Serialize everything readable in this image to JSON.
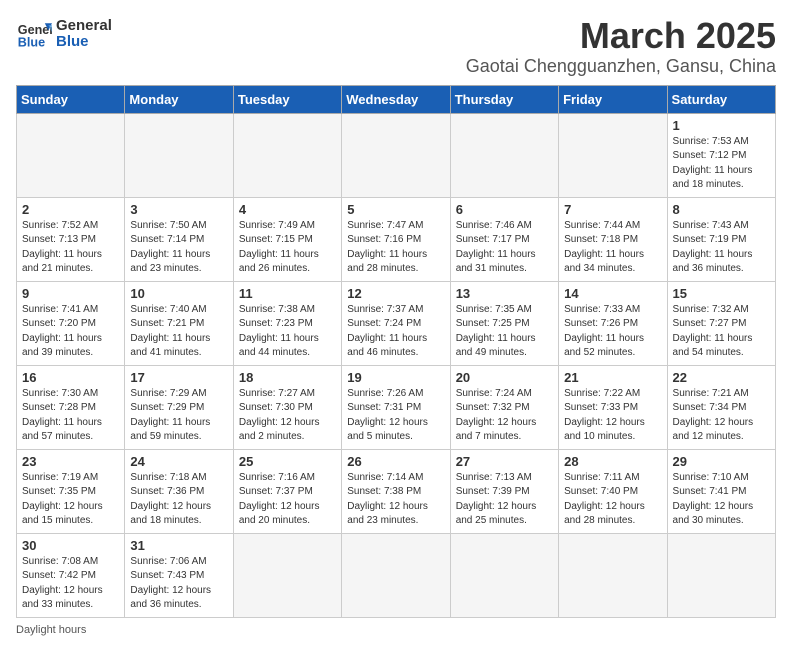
{
  "header": {
    "logo_text_general": "General",
    "logo_text_blue": "Blue",
    "month_title": "March 2025",
    "location": "Gaotai Chengguanzhen, Gansu, China"
  },
  "days_of_week": [
    "Sunday",
    "Monday",
    "Tuesday",
    "Wednesday",
    "Thursday",
    "Friday",
    "Saturday"
  ],
  "weeks": [
    [
      {
        "day": "",
        "empty": true
      },
      {
        "day": "",
        "empty": true
      },
      {
        "day": "",
        "empty": true
      },
      {
        "day": "",
        "empty": true
      },
      {
        "day": "",
        "empty": true
      },
      {
        "day": "",
        "empty": true
      },
      {
        "day": "1",
        "sunrise": "7:53 AM",
        "sunset": "7:12 PM",
        "daylight": "11 hours and 18 minutes."
      }
    ],
    [
      {
        "day": "2",
        "sunrise": "7:52 AM",
        "sunset": "7:13 PM",
        "daylight": "11 hours and 21 minutes."
      },
      {
        "day": "3",
        "sunrise": "7:50 AM",
        "sunset": "7:14 PM",
        "daylight": "11 hours and 23 minutes."
      },
      {
        "day": "4",
        "sunrise": "7:49 AM",
        "sunset": "7:15 PM",
        "daylight": "11 hours and 26 minutes."
      },
      {
        "day": "5",
        "sunrise": "7:47 AM",
        "sunset": "7:16 PM",
        "daylight": "11 hours and 28 minutes."
      },
      {
        "day": "6",
        "sunrise": "7:46 AM",
        "sunset": "7:17 PM",
        "daylight": "11 hours and 31 minutes."
      },
      {
        "day": "7",
        "sunrise": "7:44 AM",
        "sunset": "7:18 PM",
        "daylight": "11 hours and 34 minutes."
      },
      {
        "day": "8",
        "sunrise": "7:43 AM",
        "sunset": "7:19 PM",
        "daylight": "11 hours and 36 minutes."
      }
    ],
    [
      {
        "day": "9",
        "sunrise": "7:41 AM",
        "sunset": "7:20 PM",
        "daylight": "11 hours and 39 minutes."
      },
      {
        "day": "10",
        "sunrise": "7:40 AM",
        "sunset": "7:21 PM",
        "daylight": "11 hours and 41 minutes."
      },
      {
        "day": "11",
        "sunrise": "7:38 AM",
        "sunset": "7:23 PM",
        "daylight": "11 hours and 44 minutes."
      },
      {
        "day": "12",
        "sunrise": "7:37 AM",
        "sunset": "7:24 PM",
        "daylight": "11 hours and 46 minutes."
      },
      {
        "day": "13",
        "sunrise": "7:35 AM",
        "sunset": "7:25 PM",
        "daylight": "11 hours and 49 minutes."
      },
      {
        "day": "14",
        "sunrise": "7:33 AM",
        "sunset": "7:26 PM",
        "daylight": "11 hours and 52 minutes."
      },
      {
        "day": "15",
        "sunrise": "7:32 AM",
        "sunset": "7:27 PM",
        "daylight": "11 hours and 54 minutes."
      }
    ],
    [
      {
        "day": "16",
        "sunrise": "7:30 AM",
        "sunset": "7:28 PM",
        "daylight": "11 hours and 57 minutes."
      },
      {
        "day": "17",
        "sunrise": "7:29 AM",
        "sunset": "7:29 PM",
        "daylight": "11 hours and 59 minutes."
      },
      {
        "day": "18",
        "sunrise": "7:27 AM",
        "sunset": "7:30 PM",
        "daylight": "12 hours and 2 minutes."
      },
      {
        "day": "19",
        "sunrise": "7:26 AM",
        "sunset": "7:31 PM",
        "daylight": "12 hours and 5 minutes."
      },
      {
        "day": "20",
        "sunrise": "7:24 AM",
        "sunset": "7:32 PM",
        "daylight": "12 hours and 7 minutes."
      },
      {
        "day": "21",
        "sunrise": "7:22 AM",
        "sunset": "7:33 PM",
        "daylight": "12 hours and 10 minutes."
      },
      {
        "day": "22",
        "sunrise": "7:21 AM",
        "sunset": "7:34 PM",
        "daylight": "12 hours and 12 minutes."
      }
    ],
    [
      {
        "day": "23",
        "sunrise": "7:19 AM",
        "sunset": "7:35 PM",
        "daylight": "12 hours and 15 minutes."
      },
      {
        "day": "24",
        "sunrise": "7:18 AM",
        "sunset": "7:36 PM",
        "daylight": "12 hours and 18 minutes."
      },
      {
        "day": "25",
        "sunrise": "7:16 AM",
        "sunset": "7:37 PM",
        "daylight": "12 hours and 20 minutes."
      },
      {
        "day": "26",
        "sunrise": "7:14 AM",
        "sunset": "7:38 PM",
        "daylight": "12 hours and 23 minutes."
      },
      {
        "day": "27",
        "sunrise": "7:13 AM",
        "sunset": "7:39 PM",
        "daylight": "12 hours and 25 minutes."
      },
      {
        "day": "28",
        "sunrise": "7:11 AM",
        "sunset": "7:40 PM",
        "daylight": "12 hours and 28 minutes."
      },
      {
        "day": "29",
        "sunrise": "7:10 AM",
        "sunset": "7:41 PM",
        "daylight": "12 hours and 30 minutes."
      }
    ],
    [
      {
        "day": "30",
        "sunrise": "7:08 AM",
        "sunset": "7:42 PM",
        "daylight": "12 hours and 33 minutes."
      },
      {
        "day": "31",
        "sunrise": "7:06 AM",
        "sunset": "7:43 PM",
        "daylight": "12 hours and 36 minutes."
      },
      {
        "day": "",
        "empty": true
      },
      {
        "day": "",
        "empty": true
      },
      {
        "day": "",
        "empty": true
      },
      {
        "day": "",
        "empty": true
      },
      {
        "day": "",
        "empty": true
      }
    ]
  ],
  "footer": {
    "note": "Daylight hours"
  }
}
